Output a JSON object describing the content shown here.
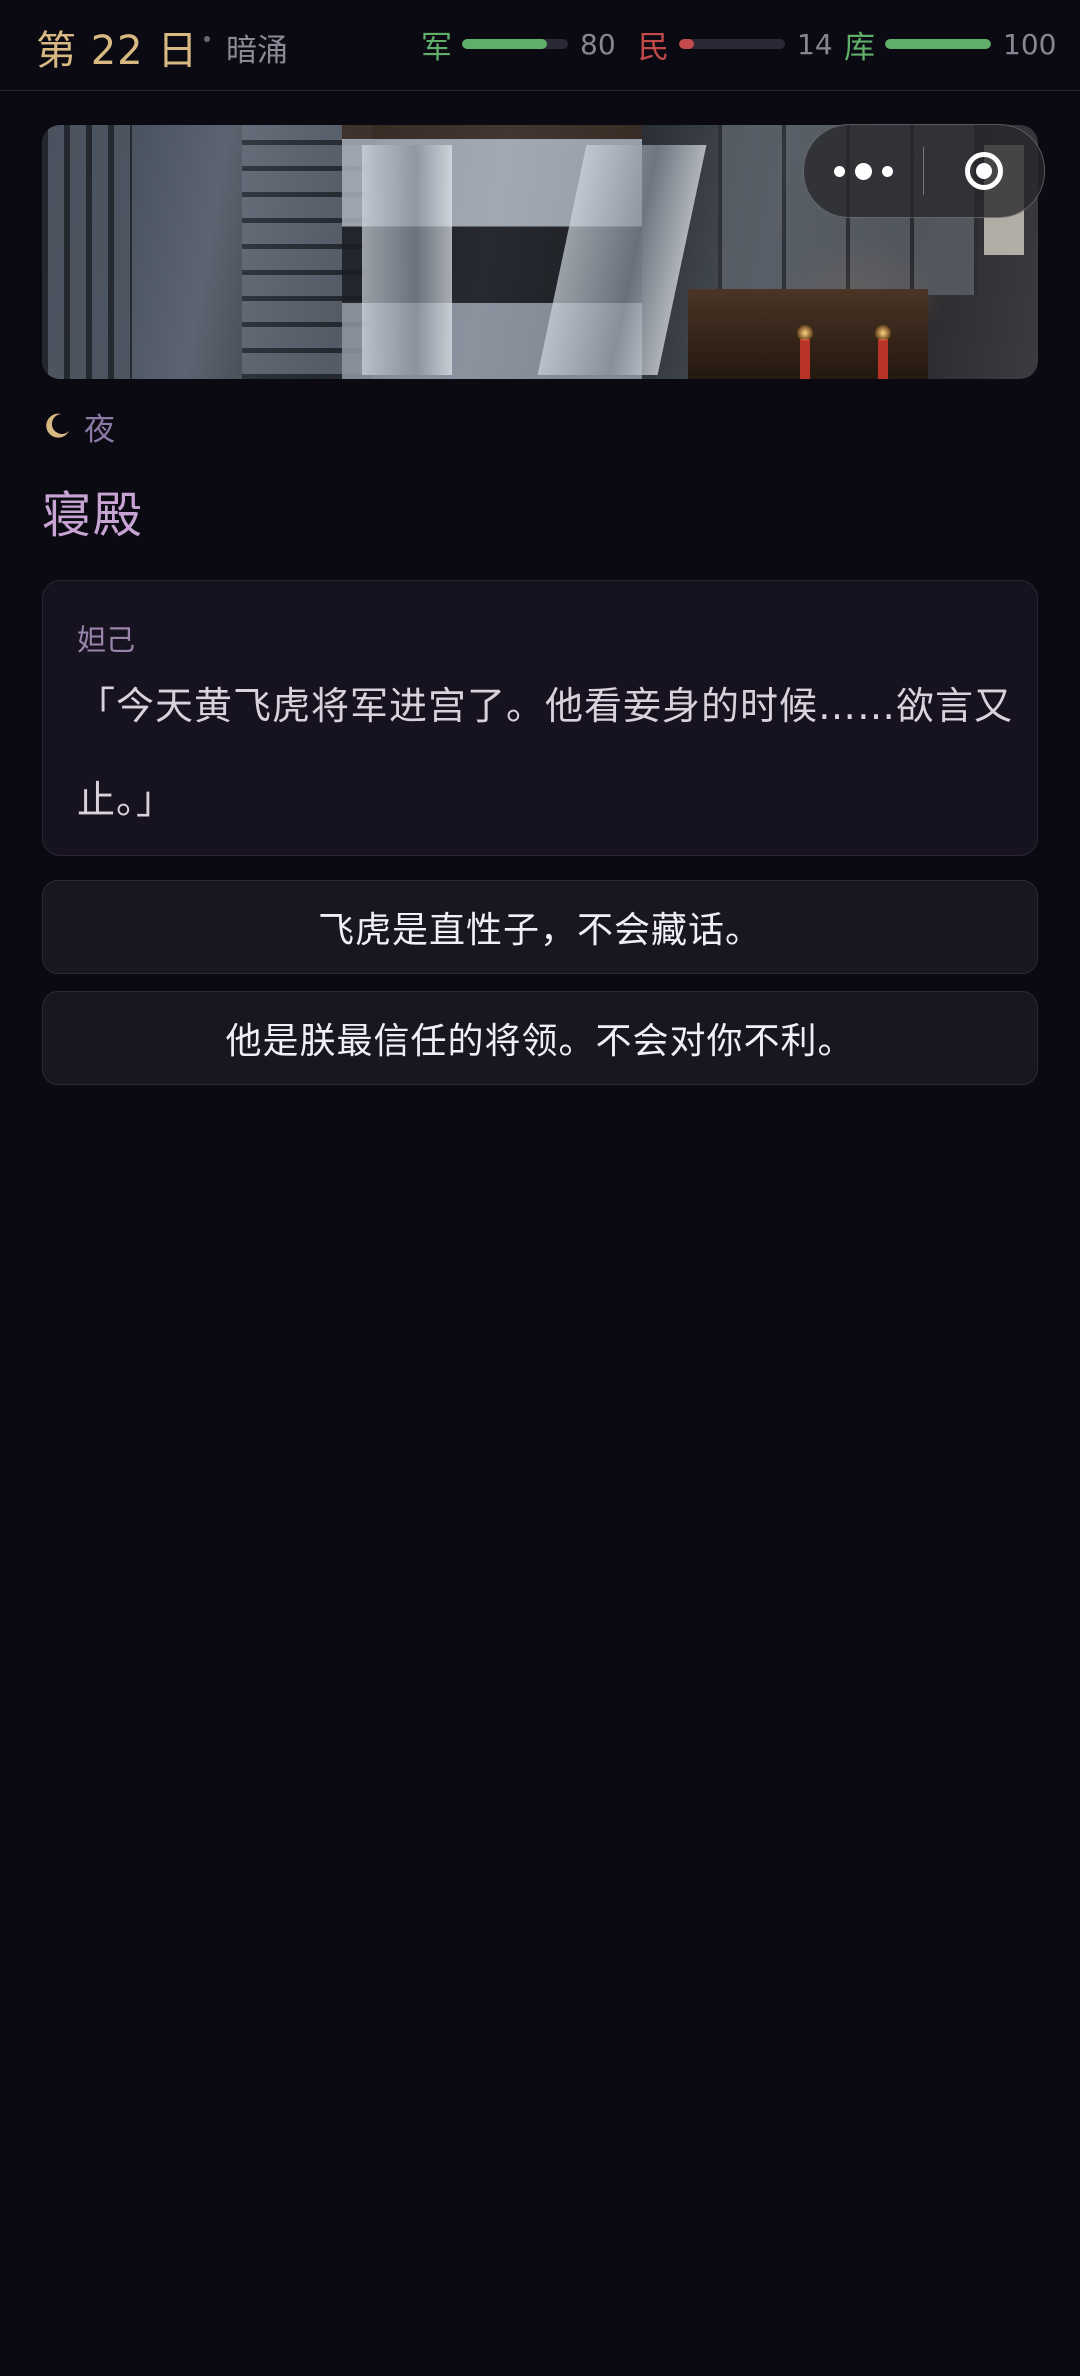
{
  "header": {
    "day": "第 22 日",
    "chapter": "暗涌",
    "stats": [
      {
        "label": "军",
        "value": "80",
        "level": 0.8,
        "color": "#5fae6a"
      },
      {
        "label": "民",
        "value": "14",
        "level": 0.14,
        "color": "#c24a4a"
      },
      {
        "label": "库",
        "value": "100",
        "level": 1.0,
        "color": "#5fae6a"
      }
    ]
  },
  "capsule": {
    "more_icon": "more-dots-icon",
    "close_icon": "target-close-icon"
  },
  "scene": {
    "time_icon": "moon-icon",
    "time_of_day": "夜",
    "location": "寝殿"
  },
  "dialogue": {
    "speaker": "妲己",
    "text": "「今天黄飞虎将军进宫了。他看妾身的时候……欲言又止。」"
  },
  "choices": [
    {
      "label": "飞虎是直性子，不会藏话。"
    },
    {
      "label": "他是朕最信任的将领。不会对你不利。"
    }
  ]
}
